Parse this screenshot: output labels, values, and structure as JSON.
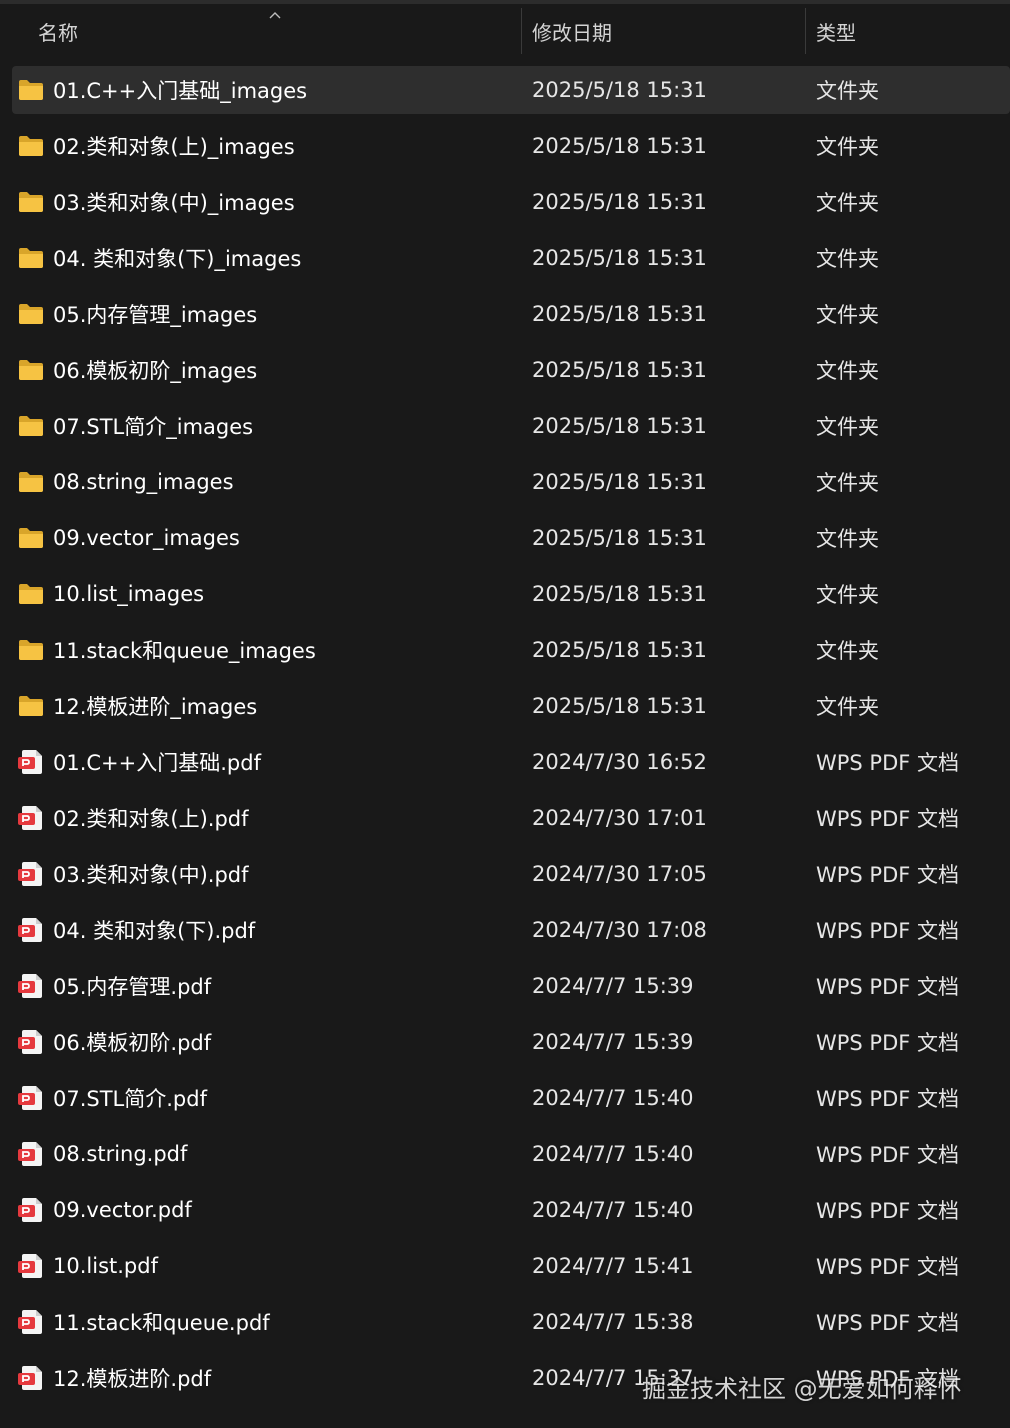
{
  "columns": {
    "name": "名称",
    "date": "修改日期",
    "type": "类型"
  },
  "icons": {
    "folder": "folder-icon",
    "pdf": "pdf-file-icon",
    "sort": "sort-ascending-icon"
  },
  "colors": {
    "folder": "#F6C343",
    "pdf": "#E5393E",
    "selected_row": "#2E2E2E"
  },
  "files": [
    {
      "name": "01.C++入门基础_images",
      "date": "2025/5/18 15:31",
      "type": "文件夹",
      "kind": "folder",
      "selected": true
    },
    {
      "name": "02.类和对象(上)_images",
      "date": "2025/5/18 15:31",
      "type": "文件夹",
      "kind": "folder"
    },
    {
      "name": "03.类和对象(中)_images",
      "date": "2025/5/18 15:31",
      "type": "文件夹",
      "kind": "folder"
    },
    {
      "name": "04. 类和对象(下)_images",
      "date": "2025/5/18 15:31",
      "type": "文件夹",
      "kind": "folder"
    },
    {
      "name": "05.内存管理_images",
      "date": "2025/5/18 15:31",
      "type": "文件夹",
      "kind": "folder"
    },
    {
      "name": "06.模板初阶_images",
      "date": "2025/5/18 15:31",
      "type": "文件夹",
      "kind": "folder"
    },
    {
      "name": "07.STL简介_images",
      "date": "2025/5/18 15:31",
      "type": "文件夹",
      "kind": "folder"
    },
    {
      "name": "08.string_images",
      "date": "2025/5/18 15:31",
      "type": "文件夹",
      "kind": "folder"
    },
    {
      "name": "09.vector_images",
      "date": "2025/5/18 15:31",
      "type": "文件夹",
      "kind": "folder"
    },
    {
      "name": "10.list_images",
      "date": "2025/5/18 15:31",
      "type": "文件夹",
      "kind": "folder"
    },
    {
      "name": "11.stack和queue_images",
      "date": "2025/5/18 15:31",
      "type": "文件夹",
      "kind": "folder"
    },
    {
      "name": "12.模板进阶_images",
      "date": "2025/5/18 15:31",
      "type": "文件夹",
      "kind": "folder"
    },
    {
      "name": "01.C++入门基础.pdf",
      "date": "2024/7/30 16:52",
      "type": "WPS PDF 文档",
      "kind": "pdf"
    },
    {
      "name": "02.类和对象(上).pdf",
      "date": "2024/7/30 17:01",
      "type": "WPS PDF 文档",
      "kind": "pdf"
    },
    {
      "name": "03.类和对象(中).pdf",
      "date": "2024/7/30 17:05",
      "type": "WPS PDF 文档",
      "kind": "pdf"
    },
    {
      "name": "04. 类和对象(下).pdf",
      "date": "2024/7/30 17:08",
      "type": "WPS PDF 文档",
      "kind": "pdf"
    },
    {
      "name": "05.内存管理.pdf",
      "date": "2024/7/7 15:39",
      "type": "WPS PDF 文档",
      "kind": "pdf"
    },
    {
      "name": "06.模板初阶.pdf",
      "date": "2024/7/7 15:39",
      "type": "WPS PDF 文档",
      "kind": "pdf"
    },
    {
      "name": "07.STL简介.pdf",
      "date": "2024/7/7 15:40",
      "type": "WPS PDF 文档",
      "kind": "pdf"
    },
    {
      "name": "08.string.pdf",
      "date": "2024/7/7 15:40",
      "type": "WPS PDF 文档",
      "kind": "pdf"
    },
    {
      "name": "09.vector.pdf",
      "date": "2024/7/7 15:40",
      "type": "WPS PDF 文档",
      "kind": "pdf"
    },
    {
      "name": "10.list.pdf",
      "date": "2024/7/7 15:41",
      "type": "WPS PDF 文档",
      "kind": "pdf"
    },
    {
      "name": "11.stack和queue.pdf",
      "date": "2024/7/7 15:38",
      "type": "WPS PDF 文档",
      "kind": "pdf"
    },
    {
      "name": "12.模板进阶.pdf",
      "date": "2024/7/7 15:37",
      "type": "WPS PDF 文档",
      "kind": "pdf"
    }
  ],
  "watermark": "掘金技术社区 @无爱如何释怀"
}
